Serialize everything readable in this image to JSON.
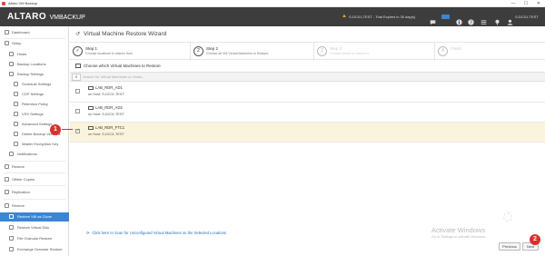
{
  "window": {
    "title": "Altaro VM Backup",
    "minimize": "—",
    "maximize": "☐",
    "close": "✕"
  },
  "header": {
    "logo_main": "ALTARO",
    "logo_sub": "VMBACKUP",
    "host_warning": "S-DC01-TEST - Trial Expires in 30 day(s)",
    "notifications_icon": "chat-icon",
    "badge_label": "LIVE",
    "user_label": "S-DC01-TEST",
    "accent": "#3a86d4",
    "warning_color": "#f0a030"
  },
  "sidebar": {
    "items": [
      {
        "label": "Dashboard",
        "level": 0,
        "icon": "dashboard-icon"
      },
      {
        "label": "Setup",
        "level": 0,
        "icon": "setup-icon",
        "expanded": true
      },
      {
        "label": "Hosts",
        "level": 1,
        "icon": "hosts-icon"
      },
      {
        "label": "Backup Locations",
        "level": 1,
        "icon": "locations-icon"
      },
      {
        "label": "Backup Settings",
        "level": 1,
        "icon": "settings-icon",
        "expanded": true
      },
      {
        "label": "Schedule Settings",
        "level": 2,
        "icon": "schedule-icon"
      },
      {
        "label": "CDP Settings",
        "level": 2,
        "icon": "cdp-icon"
      },
      {
        "label": "Retention Policy",
        "level": 2,
        "icon": "retention-icon"
      },
      {
        "label": "VSS Settings",
        "level": 2,
        "icon": "vss-icon"
      },
      {
        "label": "Advanced Settings",
        "level": 2,
        "icon": "advanced-icon"
      },
      {
        "label": "Delete Backup Versions",
        "level": 2,
        "icon": "delete-icon"
      },
      {
        "label": "Master Encryption Key",
        "level": 2,
        "icon": "key-icon"
      },
      {
        "label": "Notifications",
        "level": 1,
        "icon": "bell-icon"
      },
      {
        "label": "Restore",
        "level": 0,
        "icon": "restore-icon",
        "expanded": true
      },
      {
        "label": "Offsite Copies",
        "level": 0,
        "icon": "offsite-icon"
      },
      {
        "label": "Replication",
        "level": 0,
        "icon": "replication-icon"
      },
      {
        "label": "Restore",
        "level": 0,
        "icon": "restore-icon",
        "expanded": true
      },
      {
        "label": "Restore VM as Clone",
        "level": 1,
        "icon": "clone-icon",
        "active": true
      },
      {
        "label": "Restore Virtual Disk",
        "level": 1,
        "icon": "disk-icon"
      },
      {
        "label": "File Granular Restore",
        "level": 1,
        "icon": "file-icon"
      },
      {
        "label": "Exchange Granular Restore",
        "level": 1,
        "icon": "exchange-icon"
      }
    ]
  },
  "wizard": {
    "title": "Virtual Machine Restore Wizard",
    "steps": [
      {
        "name": "Step 1",
        "desc": "Choose locations to restore from",
        "state": "done"
      },
      {
        "name": "Step 2",
        "desc": "Choose all VM Virtual Machines to Restore",
        "state": "current",
        "num": "2"
      },
      {
        "name": "Step 3",
        "desc": "Choose where to restore to",
        "state": "pending",
        "num": "3"
      },
      {
        "name": "Finish",
        "desc": "",
        "state": "pending",
        "num": "4"
      }
    ],
    "choose_label": "Choose which Virtual Machines to Restore",
    "search_placeholder": "Search for Virtual Machines or Hosts..."
  },
  "vms": [
    {
      "name": "LAB_RDR_AD1",
      "host": "on Host: S-DC01-TEST",
      "checked": false
    },
    {
      "name": "LAB_RDR_AD2",
      "host": "on Host: S-DC01-TEST",
      "checked": false
    },
    {
      "name": "LAB_RDR_FTC1",
      "host": "on Host: S-DC01-TEST",
      "checked": true
    }
  ],
  "scan_link": "Click here to Scan for Unconfigured Virtual Machines on the Selected Locations",
  "activation": {
    "title": "Activate Windows",
    "subtitle": "Go to Settings to activate Windows."
  },
  "buttons": {
    "previous": "Previous",
    "next": "Next"
  },
  "callouts": {
    "one": "1",
    "two": "2",
    "color": "#d8302f"
  }
}
